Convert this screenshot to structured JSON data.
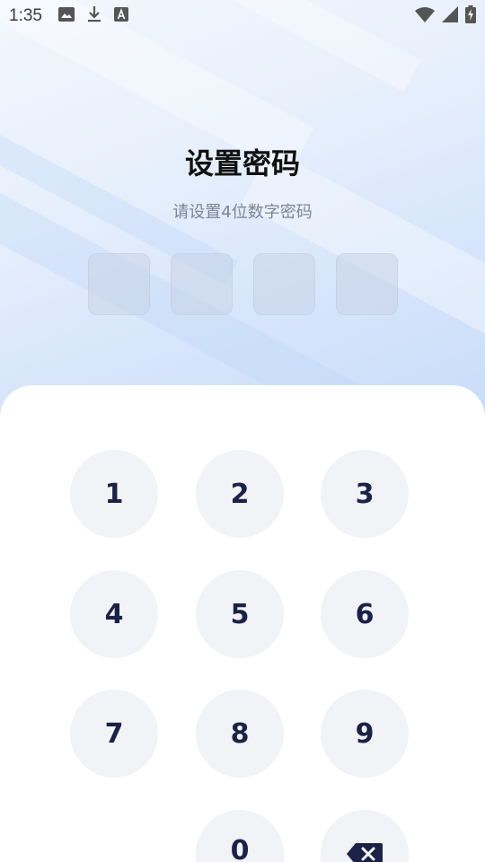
{
  "status_bar": {
    "time": "1:35",
    "left_icons": [
      "image-icon",
      "download-icon",
      "font-icon"
    ],
    "right_icons": [
      "wifi-icon",
      "signal-icon",
      "battery-charging-icon"
    ]
  },
  "header": {
    "title": "设置密码",
    "subtitle": "请设置4位数字密码"
  },
  "pin": {
    "length": 4,
    "entered": 0
  },
  "keypad": {
    "keys": [
      "1",
      "2",
      "3",
      "4",
      "5",
      "6",
      "7",
      "8",
      "9",
      "0"
    ],
    "delete_icon": "backspace-icon"
  },
  "colors": {
    "key_bg": "#f2f3f6",
    "key_text": "#1b2247",
    "title": "#111111",
    "subtitle": "#7d8592"
  }
}
